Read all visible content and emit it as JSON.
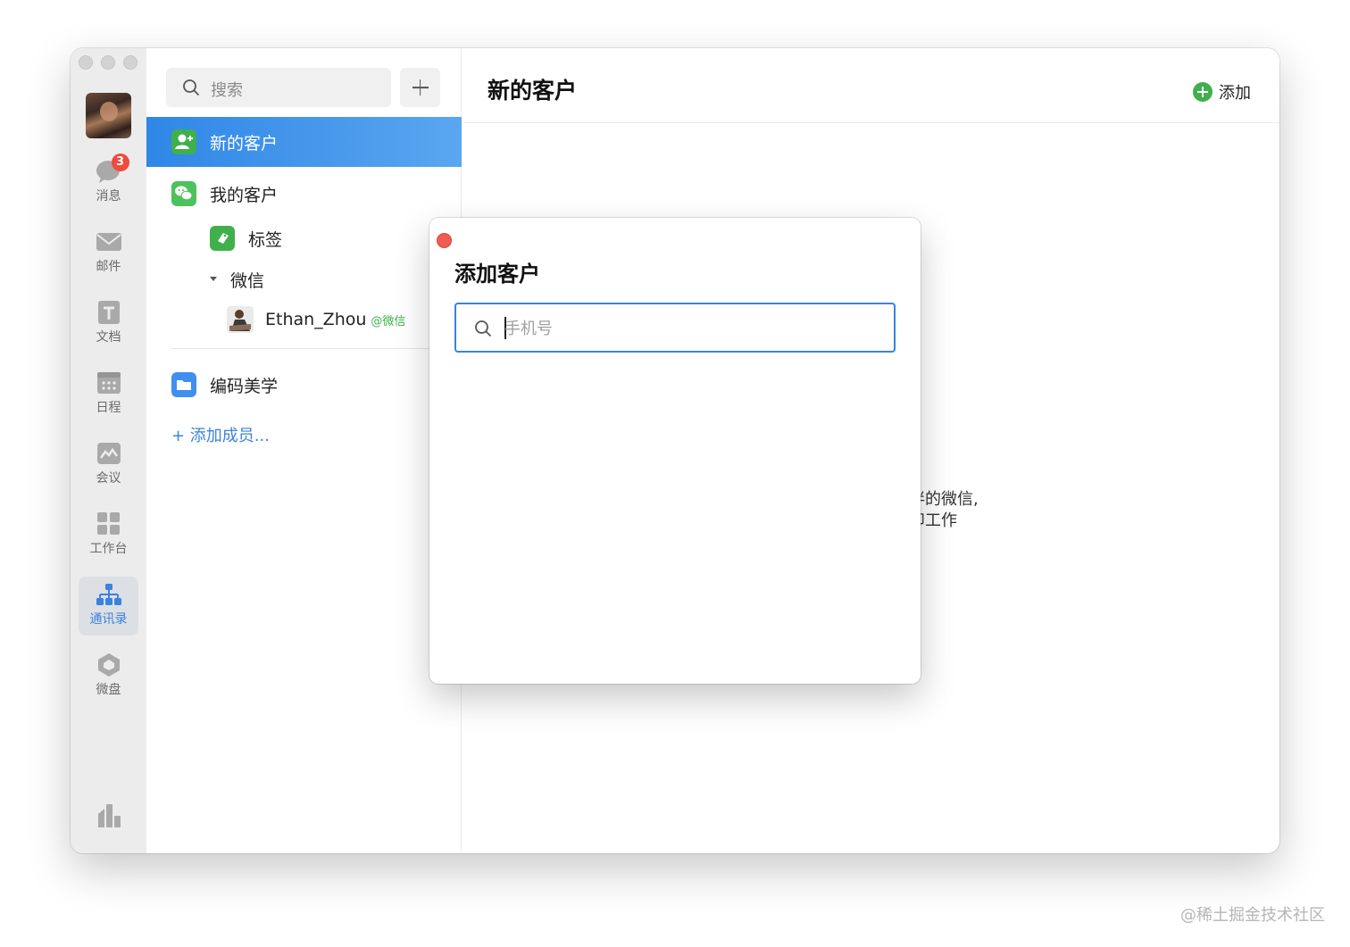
{
  "rail": {
    "badge_count": "3",
    "items": [
      {
        "label": "消息"
      },
      {
        "label": "邮件"
      },
      {
        "label": "文档"
      },
      {
        "label": "日程"
      },
      {
        "label": "会议"
      },
      {
        "label": "工作台"
      },
      {
        "label": "通讯录"
      },
      {
        "label": "微盘"
      }
    ]
  },
  "contacts": {
    "search_placeholder": "搜索",
    "nav": {
      "new_customers": "新的客户",
      "my_customers": "我的客户",
      "tags": "标签",
      "wechat_group": "微信",
      "contact_name": "Ethan_Zhou",
      "contact_tag": "@微信",
      "org": "编码美学",
      "add_member": "+ 添加成员..."
    }
  },
  "main": {
    "title": "新的客户",
    "add_label": "添加",
    "hint_line1": "伴的微信,",
    "hint_line2": "卯工作"
  },
  "modal": {
    "title": "添加客户",
    "phone_placeholder": "手机号",
    "phone_value": ""
  },
  "watermark": "@稀土掘金技术社区",
  "colors": {
    "accent": "#3b82e0",
    "selected_row": "#2f87e6",
    "badge": "#f04a3e",
    "green_icon": "#3fb04c",
    "close_dot": "#ee5c52"
  }
}
